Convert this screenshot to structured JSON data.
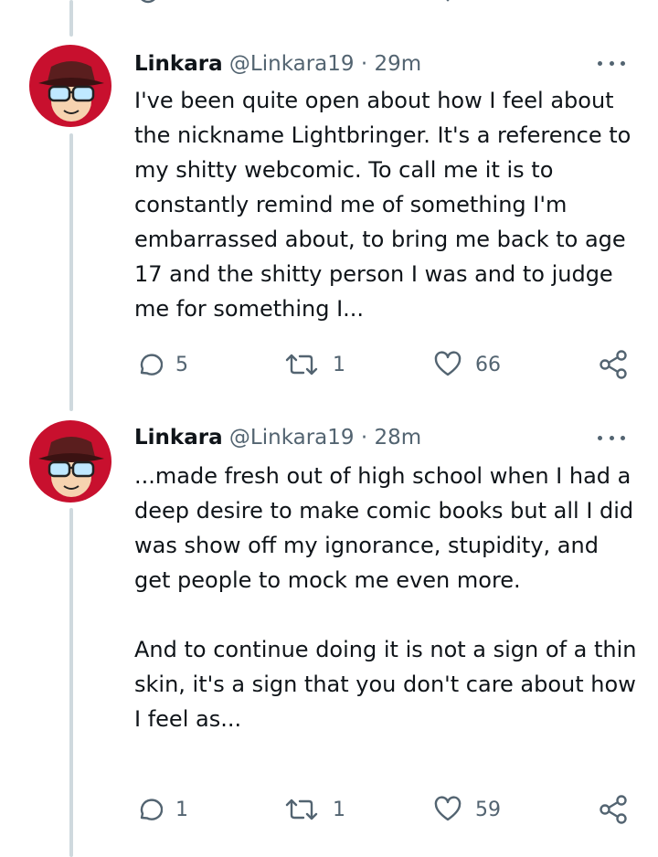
{
  "tweets": [
    {
      "name": "Linkara",
      "handle": "@Linkara19",
      "separator": "·",
      "time": "29m",
      "text": [
        "I've been quite open about how I feel about the nickname Lightbringer. It's a reference to my shitty webcomic. To call me it is to constantly remind me of something I'm embarrassed about, to bring me back to age 17 and the shitty person I was and to judge me for something I..."
      ],
      "replies": "5",
      "retweets": "1",
      "likes": "66"
    },
    {
      "name": "Linkara",
      "handle": "@Linkara19",
      "separator": "·",
      "time": "28m",
      "text": [
        "...made fresh out of high school when I had a deep desire to make comic books but all I did was show off my ignorance, stupidity, and get people to mock me even more.",
        "And to continue doing it is not a sign of a thin skin, it's a sign that you don't care about how I feel as..."
      ],
      "replies": "1",
      "retweets": "1",
      "likes": "59"
    }
  ],
  "icons": {
    "avatar": "red-hat-glasses-avatar",
    "reply": "speech-bubble-icon",
    "retweet": "retweet-arrows-icon",
    "like": "heart-icon",
    "share": "share-icon",
    "more": "more-dots-icon"
  },
  "colors": {
    "text": "#0f1419",
    "secondary": "#536471",
    "thread_line": "#cfd9de",
    "avatar_red": "#c8102e"
  }
}
